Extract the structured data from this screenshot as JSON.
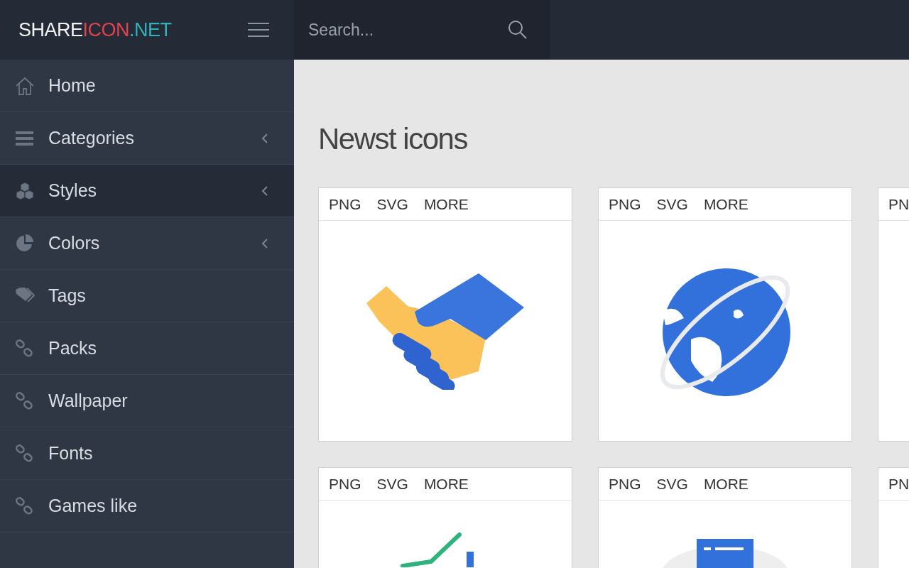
{
  "logo": [
    {
      "text": "SHARE",
      "color": "#f2f2f2"
    },
    {
      "text": "ICON",
      "color": "#e0424f"
    },
    {
      "text": ".NET",
      "color": "#2fb3bd"
    }
  ],
  "search": {
    "placeholder": "Search..."
  },
  "sidebar": {
    "items": [
      {
        "label": "Home",
        "submenu": false,
        "selected": false
      },
      {
        "label": "Categories",
        "submenu": true,
        "selected": false
      },
      {
        "label": "Styles",
        "submenu": true,
        "selected": true
      },
      {
        "label": "Colors",
        "submenu": true,
        "selected": false
      },
      {
        "label": "Tags",
        "submenu": false,
        "selected": false
      },
      {
        "label": "Packs",
        "submenu": false,
        "selected": false
      },
      {
        "label": "Wallpaper",
        "submenu": false,
        "selected": false
      },
      {
        "label": "Fonts",
        "submenu": false,
        "selected": false
      },
      {
        "label": "Games like",
        "submenu": false,
        "selected": false
      }
    ]
  },
  "heading": "Newst icons",
  "cards": [
    {
      "links": [
        "PNG",
        "SVG",
        "MORE"
      ]
    },
    {
      "links": [
        "PNG",
        "SVG",
        "MORE"
      ]
    },
    {
      "links": [
        "PN"
      ]
    },
    {
      "links": [
        "PNG",
        "SVG",
        "MORE"
      ]
    },
    {
      "links": [
        "PNG",
        "SVG",
        "MORE"
      ]
    },
    {
      "links": [
        "PN"
      ]
    }
  ]
}
